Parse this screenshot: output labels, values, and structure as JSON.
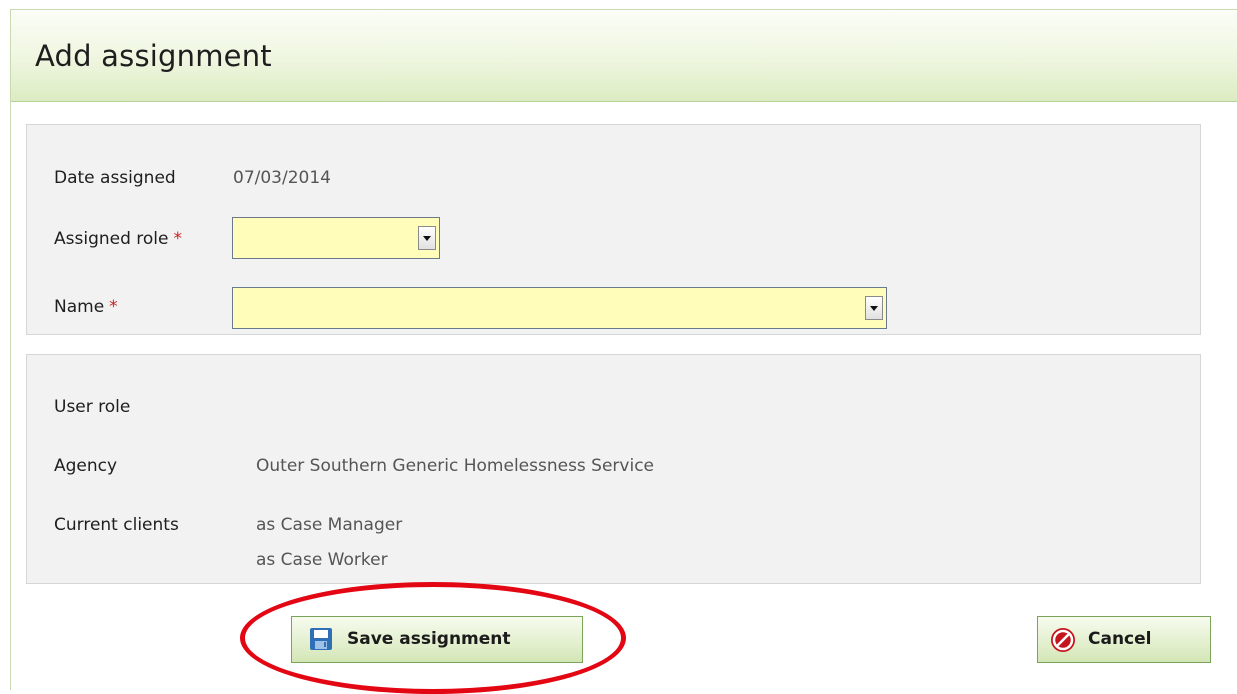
{
  "dialog": {
    "title": "Add assignment"
  },
  "form": {
    "date_assigned_label": "Date assigned",
    "date_assigned_value": "07/03/2014",
    "assigned_role_label": "Assigned role",
    "name_label": "Name",
    "required_marker": "*",
    "assigned_role_value": "",
    "name_value": ""
  },
  "info": {
    "user_role_label": "User role",
    "agency_label": "Agency",
    "agency_value": "Outer Southern Generic Homelessness Service",
    "current_clients_label": "Current clients",
    "current_clients": [
      "as Case Manager",
      "as Case Worker"
    ]
  },
  "actions": {
    "save_label": "Save assignment",
    "cancel_label": "Cancel"
  },
  "colors": {
    "header_gradient_end": "#dcecc2",
    "required_input_bg": "#fffdb9",
    "required_marker": "#cc1f1f",
    "highlight_ring": "#e30613",
    "cancel_icon": "#c4151c",
    "save_icon": "#2f6fb5"
  },
  "icons": {
    "save": "floppy-disk-icon",
    "cancel": "no-entry-icon",
    "dropdown": "chevron-down-icon"
  }
}
